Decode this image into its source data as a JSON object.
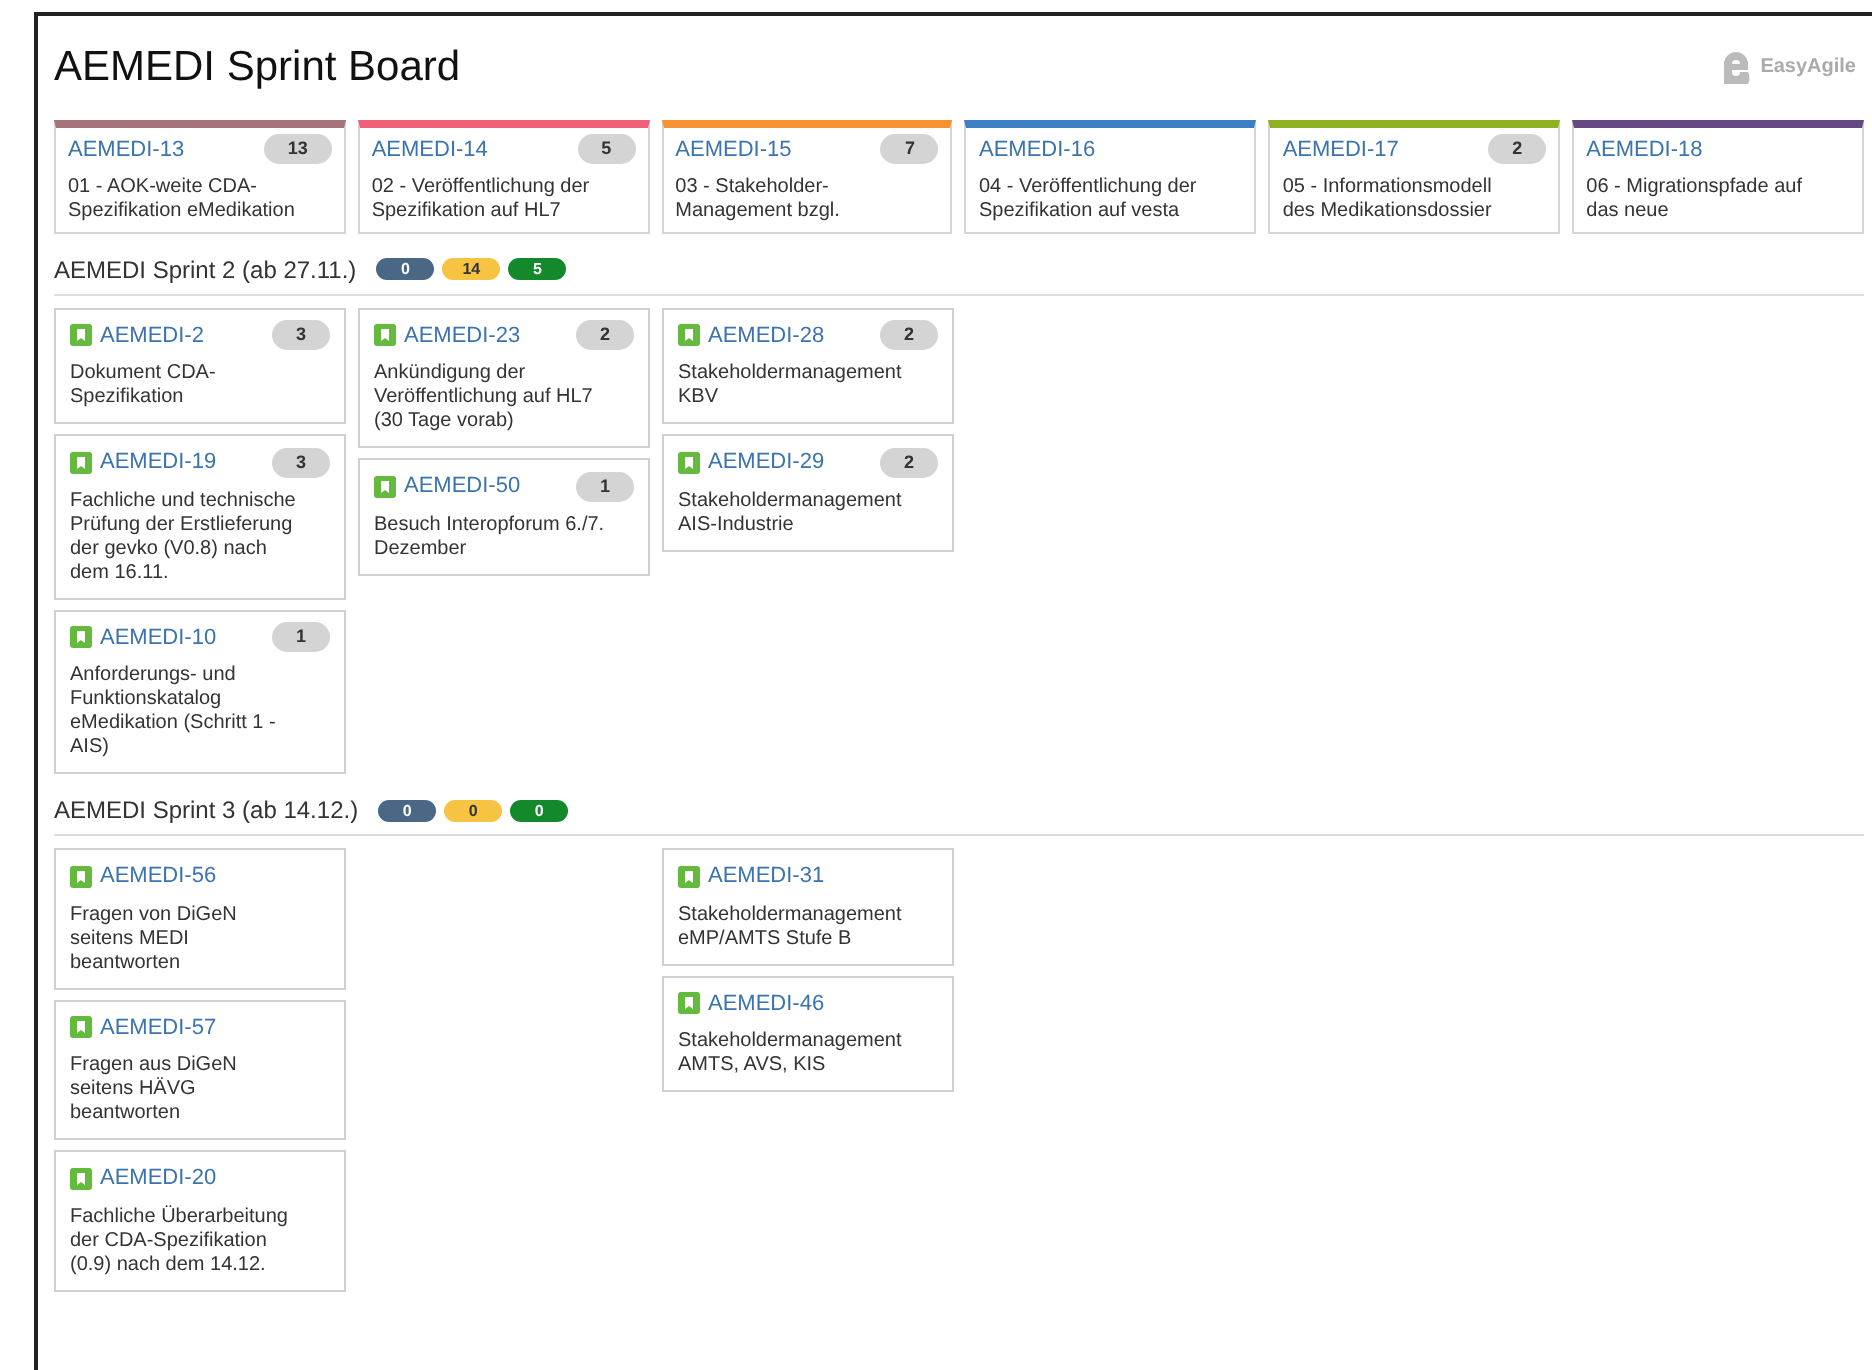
{
  "title": "AEMEDI Sprint Board",
  "brand": "EasyAgile",
  "epics": [
    {
      "key": "AEMEDI-13",
      "points": "13",
      "summary": "01 - AOK-weite CDA-Spezifikation eMedikation",
      "color": "#a5737b"
    },
    {
      "key": "AEMEDI-14",
      "points": "5",
      "summary": "02 - Veröffentlichung der Spezifikation auf HL7",
      "color": "#f06078"
    },
    {
      "key": "AEMEDI-15",
      "points": "7",
      "summary": "03 - Stakeholder-Management bzgl.",
      "color": "#f79232"
    },
    {
      "key": "AEMEDI-16",
      "summary": "04 - Veröffentlichung der Spezifikation auf vesta",
      "color": "#3b7fc4"
    },
    {
      "key": "AEMEDI-17",
      "points": "2",
      "summary": "05 - Informationsmodell des Medikationsdossier",
      "color": "#8eb021"
    },
    {
      "key": "AEMEDI-18",
      "summary": "06 - Migrationspfade auf das neue",
      "color": "#654982"
    }
  ],
  "sprints": [
    {
      "title": "AEMEDI Sprint 2 (ab 27.11.)",
      "counts": [
        {
          "value": "0",
          "color": "#4a6785"
        },
        {
          "value": "14",
          "color": "#f6c342"
        },
        {
          "value": "5",
          "color": "#14892c"
        }
      ],
      "columns": [
        {
          "issues": [
            {
              "key": "AEMEDI-2",
              "points": "3",
              "summary": "Dokument CDA-Spezifikation"
            },
            {
              "key": "AEMEDI-19",
              "points": "3",
              "summary": "Fachliche und technische Prüfung der Erstlieferung der gevko (V0.8) nach dem 16.11."
            },
            {
              "key": "AEMEDI-10",
              "points": "1",
              "summary": "Anforderungs- und Funktionskatalog eMedikation (Schritt 1 - AIS)"
            }
          ]
        },
        {
          "issues": [
            {
              "key": "AEMEDI-23",
              "points": "2",
              "summary": "Ankündigung der Veröffentlichung auf HL7 (30 Tage vorab)"
            },
            {
              "key": "AEMEDI-50",
              "points": "1",
              "summary": "Besuch Interopforum 6./7. Dezember"
            }
          ]
        },
        {
          "issues": [
            {
              "key": "AEMEDI-28",
              "points": "2",
              "summary": "Stakeholdermanagement KBV"
            },
            {
              "key": "AEMEDI-29",
              "points": "2",
              "summary": "Stakeholdermanagement AIS-Industrie"
            }
          ]
        }
      ]
    },
    {
      "title": "AEMEDI Sprint 3 (ab 14.12.)",
      "counts": [
        {
          "value": "0",
          "color": "#4a6785"
        },
        {
          "value": "0",
          "color": "#f6c342"
        },
        {
          "value": "0",
          "color": "#14892c"
        }
      ],
      "columns": [
        {
          "issues": [
            {
              "key": "AEMEDI-56",
              "summary": "Fragen von DiGeN seitens MEDI beantworten"
            },
            {
              "key": "AEMEDI-57",
              "summary": "Fragen aus DiGeN seitens HÄVG beantworten"
            },
            {
              "key": "AEMEDI-20",
              "summary": "Fachliche Überarbeitung der CDA-Spezifikation (0.9) nach dem 14.12."
            }
          ]
        },
        {},
        {
          "issues": [
            {
              "key": "AEMEDI-31",
              "summary": "Stakeholdermanagement eMP/AMTS Stufe B"
            },
            {
              "key": "AEMEDI-46",
              "summary": "Stakeholdermanagement AMTS, AVS, KIS"
            }
          ]
        }
      ]
    }
  ]
}
